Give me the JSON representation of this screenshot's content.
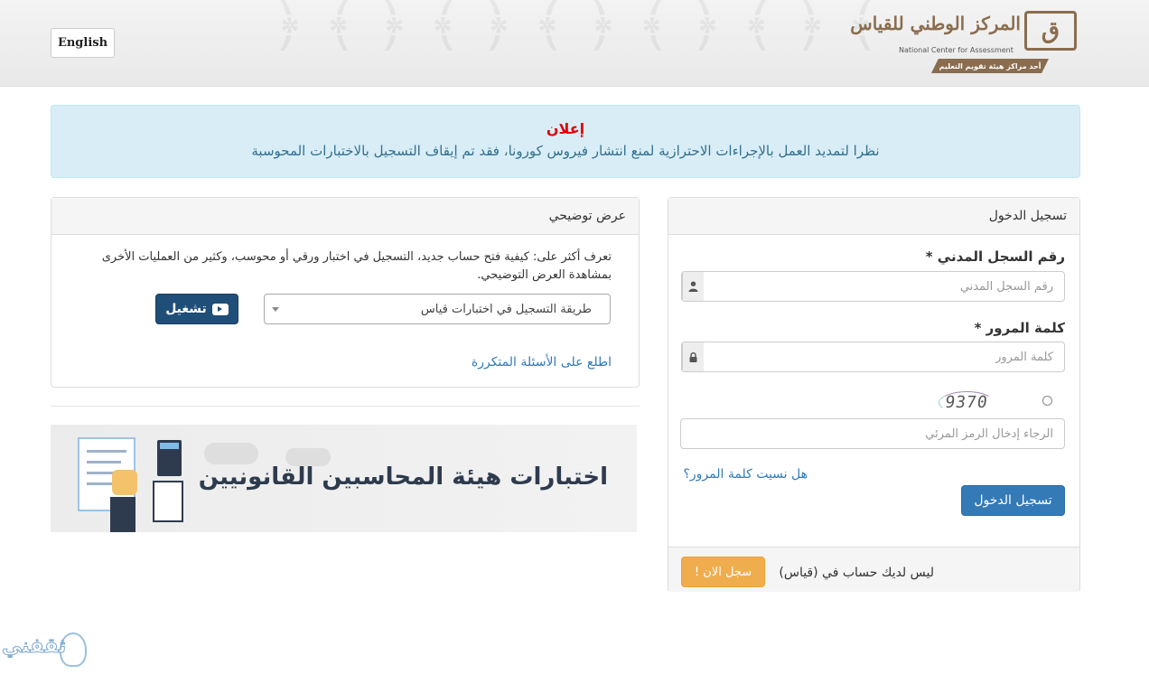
{
  "header": {
    "language_button": "English",
    "logo": {
      "arabic_name": "المركز الوطني للقياس",
      "english_name": "National Center for Assessment",
      "ribbon": "أحد مراكز هيئة تقويم التعليم"
    }
  },
  "announcement": {
    "title": "إعلان",
    "text": "نظرا لتمديد العمل بالإجراءات الاحترازية لمنع انتشار فيروس كورونا، فقد تم إيقاف التسجيل بالاختبارات المحوسبة"
  },
  "login": {
    "heading": "تسجيل الدخول",
    "id_label": "رقم السجل المدني *",
    "id_placeholder": "رقم السجل المدني",
    "password_label": "كلمة المرور *",
    "password_placeholder": "كلمة المرور",
    "captcha_text": "9370",
    "captcha_placeholder": "الرجاء إدخال الرمز المرئي",
    "forgot_password": "هل نسيت كلمة المرور؟",
    "submit": "تسجيل الدخول",
    "no_account": "ليس لديك حساب في (قياس)",
    "register": "سجل الان !"
  },
  "demo": {
    "heading": "عرض توضيحي",
    "description": "تعرف أكثر على: كيفية فتح حساب جديد، التسجيل في اختبار ورقي أو محوسب، وكثير من العمليات الأخرى بمشاهدة العرض التوضيحي.",
    "select_value": "طريقة التسجيل في اختبارات قياس",
    "play_button": "تشغيل",
    "faq_link": "اطلع على الأسئلة المتكررة"
  },
  "banner": {
    "text": "اختبارات هيئة المحاسبين القانونيين"
  },
  "watermark": {
    "text": "ثقفني"
  },
  "colors": {
    "brand_brown": "#8a6d4f",
    "primary_blue": "#337ab7",
    "warning_orange": "#f0ad4e",
    "alert_red": "#e00000",
    "alert_bg": "#d9edf7"
  }
}
